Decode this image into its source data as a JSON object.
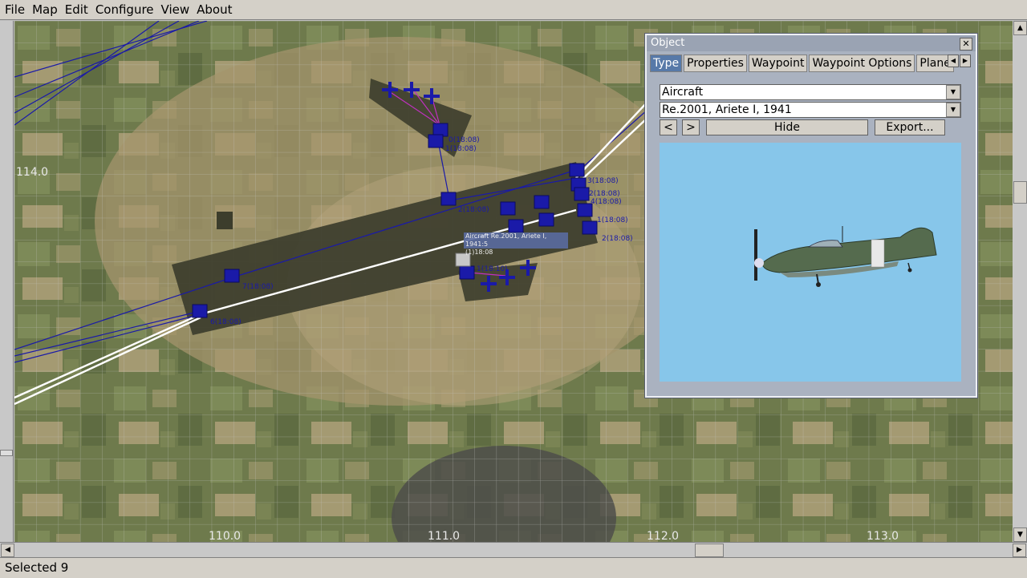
{
  "menu": [
    "File",
    "Map",
    "Edit",
    "Configure",
    "View",
    "About"
  ],
  "map": {
    "grid_labels_x": [
      "110.0",
      "111.0",
      "112.0",
      "113.0"
    ],
    "grid_label_y": "114.0",
    "waypoint_labels": [
      {
        "text": "0(18:08)"
      },
      {
        "text": "1(18:08)"
      },
      {
        "text": "2(18:08)"
      },
      {
        "text": "3(18:08)"
      },
      {
        "text": "2(18:08)"
      },
      {
        "text": "4(18:08)"
      },
      {
        "text": "1(18:08)"
      },
      {
        "text": "2(18:08)"
      },
      {
        "text": "7(18:08)"
      },
      {
        "text": "6(18:08)"
      },
      {
        "text": "1(18:10)"
      }
    ],
    "tooltip": {
      "line1": "Aircraft Re.2001, Ariete I, 1941:5",
      "line2": "(1)18:08"
    }
  },
  "dialog": {
    "title": "Object",
    "tabs": [
      "Type",
      "Properties",
      "Waypoint",
      "Waypoint Options",
      "Plane"
    ],
    "active_tab": "Type",
    "category": "Aircraft",
    "model": "Re.2001, Ariete I, 1941",
    "prev_label": "<",
    "next_label": ">",
    "hide_label": "Hide",
    "export_label": "Export...",
    "preview_bg": "#87c6ea"
  },
  "status": {
    "text": "Selected 9"
  },
  "colors": {
    "route_blue": "#1a1aa8",
    "route_white": "#ffffff",
    "route_magenta": "#c030c0",
    "grid": "#c8c8c8"
  }
}
